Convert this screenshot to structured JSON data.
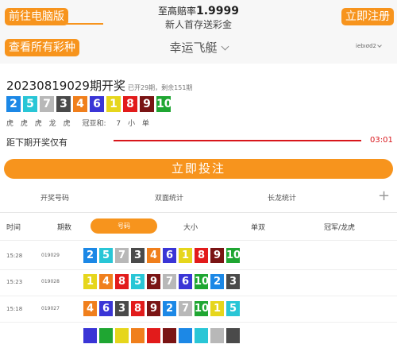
{
  "header": {
    "desktop_btn": "前往电脑版",
    "title_prefix": "至高赔率",
    "title_value": "1.9999",
    "subtitle": "新人首存送彩金",
    "register_btn": "立即注册",
    "all_lotteries_btn": "查看所有彩种",
    "game_name": "幸运飞艇",
    "right_label": "iebıσd2"
  },
  "draw": {
    "issue": "20230819029期开奖",
    "progress": "已开29期，剩余151期",
    "numbers": [
      2,
      5,
      7,
      3,
      4,
      6,
      1,
      8,
      9,
      10
    ],
    "attrs": [
      "虎",
      "虎",
      "虎",
      "龙",
      "虎"
    ],
    "sum_label": "冠亚和:",
    "sum_value": "7",
    "size": "小",
    "parity": "单"
  },
  "countdown": {
    "label": "距下期开奖仅有",
    "time": "03:01"
  },
  "bet_btn": "立即投注",
  "tabs": [
    "开奖号码",
    "双面统计",
    "长龙统计"
  ],
  "tab_add": "+",
  "subheader": {
    "time": "时间",
    "issue": "期数",
    "numbers": "号码",
    "size": "大小",
    "parity": "单双",
    "dragon_tiger": "冠军/龙虎"
  },
  "rows": [
    {
      "time": "15:28",
      "issue": "019029",
      "numbers": [
        2,
        5,
        7,
        3,
        4,
        6,
        1,
        8,
        9,
        10
      ]
    },
    {
      "time": "15:23",
      "issue": "019028",
      "numbers": [
        1,
        4,
        8,
        5,
        9,
        7,
        6,
        10,
        2,
        3
      ]
    },
    {
      "time": "15:18",
      "issue": "019027",
      "numbers": [
        4,
        6,
        3,
        8,
        9,
        2,
        7,
        10,
        1,
        5
      ]
    }
  ],
  "ball_colors": {
    "1": "#e6d61c",
    "2": "#1c88e6",
    "3": "#4a4a4a",
    "4": "#f07f1c",
    "5": "#29c6d6",
    "6": "#3a35d6",
    "7": "#b8b8b8",
    "8": "#e21b1b",
    "9": "#7a1414",
    "10": "#1fa632"
  },
  "accent": "#f7941d"
}
